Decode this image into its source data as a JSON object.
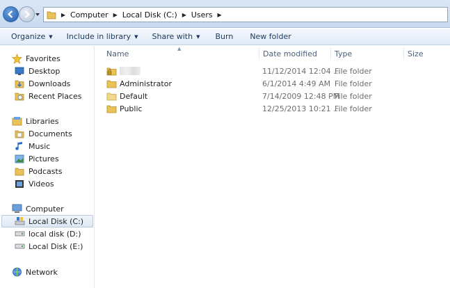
{
  "address": {
    "crumbs": [
      "Computer",
      "Local Disk (C:)",
      "Users"
    ]
  },
  "toolbar": {
    "organize": "Organize",
    "include": "Include in library",
    "share": "Share with",
    "burn": "Burn",
    "new_folder": "New folder"
  },
  "nav": {
    "favorites": "Favorites",
    "desktop": "Desktop",
    "downloads": "Downloads",
    "recent": "Recent Places",
    "libraries": "Libraries",
    "documents": "Documents",
    "music": "Music",
    "pictures": "Pictures",
    "podcasts": "Podcasts",
    "videos": "Videos",
    "computer": "Computer",
    "disk_c": "Local Disk (C:)",
    "disk_d": "local disk (D:)",
    "disk_e": "Local Disk (E:)",
    "network": "Network"
  },
  "columns": {
    "name": "Name",
    "date": "Date modified",
    "type": "Type",
    "size": "Size"
  },
  "files": [
    {
      "name": "",
      "date": "11/12/2014 12:04 ...",
      "type": "File folder"
    },
    {
      "name": "Administrator",
      "date": "6/1/2014 4:49 AM",
      "type": "File folder"
    },
    {
      "name": "Default",
      "date": "7/14/2009 12:48 PM",
      "type": "File folder"
    },
    {
      "name": "Public",
      "date": "12/25/2013 10:21 ...",
      "type": "File folder"
    }
  ],
  "icons": {
    "folder": "folder-icon",
    "locked_folder": "locked-folder-icon"
  }
}
